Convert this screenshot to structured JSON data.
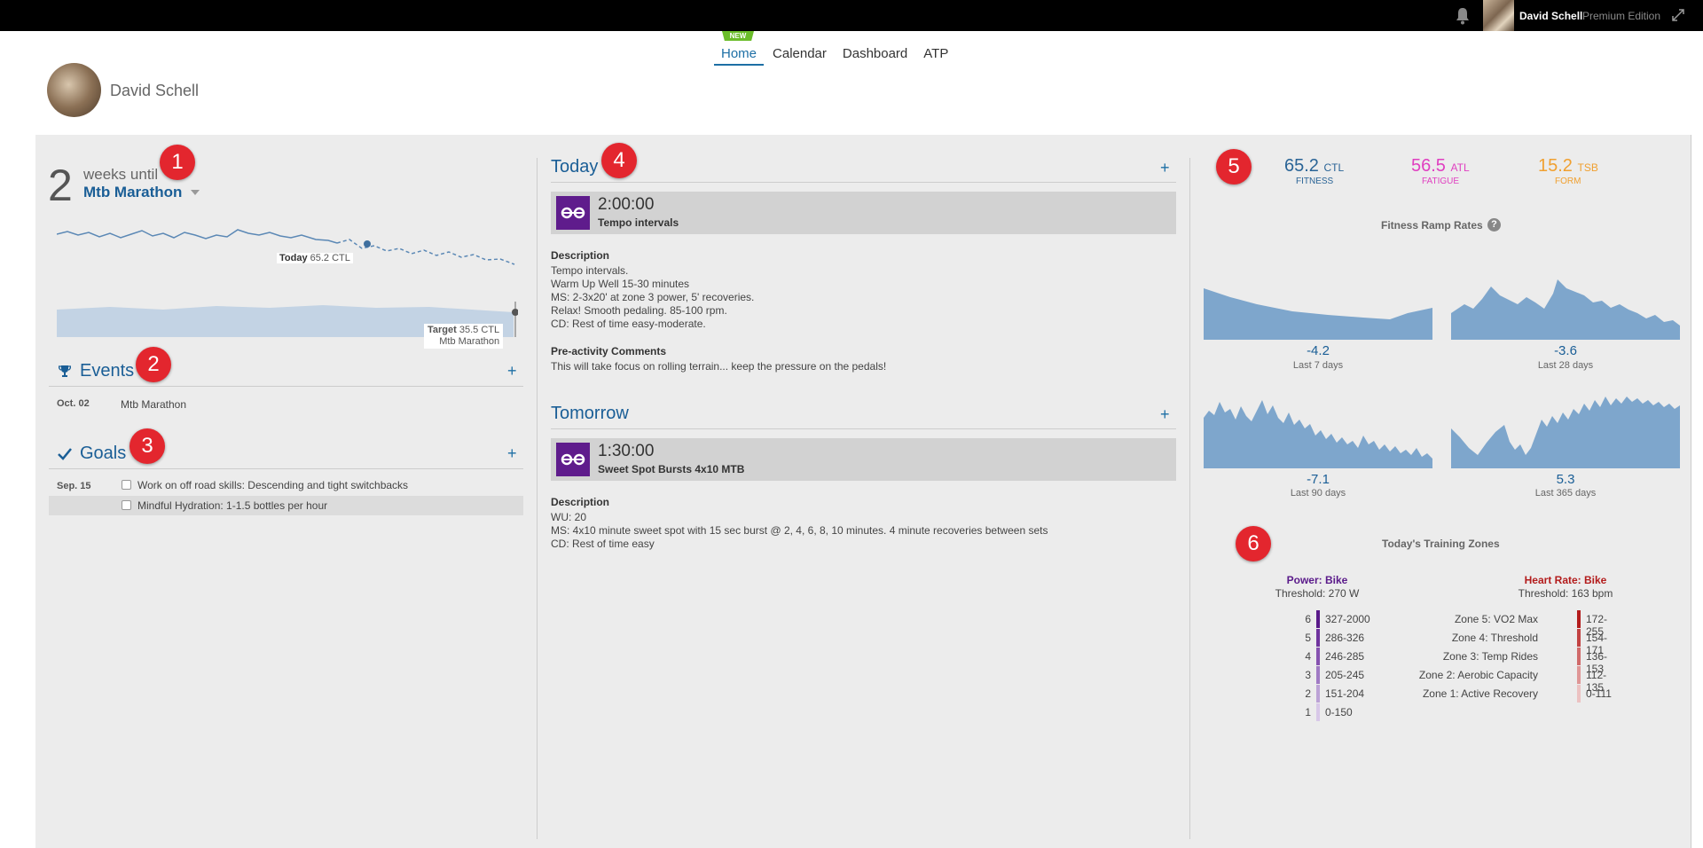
{
  "topbar": {
    "user_name": "David Schell",
    "edition": "Premium Edition"
  },
  "nav": {
    "new_tag": "NEW",
    "items": [
      {
        "label": "Home",
        "active": true
      },
      {
        "label": "Calendar",
        "active": false
      },
      {
        "label": "Dashboard",
        "active": false
      },
      {
        "label": "ATP",
        "active": false
      }
    ]
  },
  "profile": {
    "name": "David Schell"
  },
  "badges": [
    "1",
    "2",
    "3",
    "4",
    "5",
    "6"
  ],
  "countdown": {
    "weeks": "2",
    "weeks_label": "weeks until",
    "event": "Mtb Marathon",
    "today_label": "Today",
    "today_value": "65.2 CTL",
    "target_label": "Target",
    "target_value": "35.5 CTL",
    "target_event": "Mtb Marathon"
  },
  "events": {
    "title": "Events",
    "items": [
      {
        "date": "Oct. 02",
        "name": "Mtb Marathon"
      }
    ]
  },
  "goals": {
    "title": "Goals",
    "date": "Sep. 15",
    "items": [
      "Work on off road skills: Descending and tight switchbacks",
      "Mindful Hydration: 1-1.5 bottles per hour"
    ]
  },
  "today": {
    "title": "Today",
    "duration": "2:00:00",
    "workout": "Tempo intervals",
    "description_label": "Description",
    "description": [
      "Tempo intervals.",
      "Warm Up Well 15-30 minutes",
      "MS: 2-3x20' at zone 3 power, 5' recoveries.",
      "Relax! Smooth pedaling. 85-100 rpm.",
      "CD: Rest of time easy-moderate."
    ],
    "comments_label": "Pre-activity Comments",
    "comments": "This will take focus on rolling terrain... keep the pressure on the pedals!"
  },
  "tomorrow": {
    "title": "Tomorrow",
    "duration": "1:30:00",
    "workout": "Sweet Spot Bursts 4x10 MTB",
    "description_label": "Description",
    "description": [
      "WU: 20",
      "MS: 4x10 minute sweet spot with 15 sec burst @ 2, 4, 6, 8, 10 minutes. 4 minute recoveries between sets",
      "CD: Rest of time easy"
    ]
  },
  "metrics": [
    {
      "value": "65.2",
      "unit": "CTL",
      "label": "FITNESS",
      "color": "#2a6496"
    },
    {
      "value": "56.5",
      "unit": "ATL",
      "label": "FATIGUE",
      "color": "#e03fc0"
    },
    {
      "value": "15.2",
      "unit": "TSB",
      "label": "FORM",
      "color": "#f0a030"
    }
  ],
  "ramp": {
    "title": "Fitness Ramp Rates",
    "help": "?",
    "items": [
      {
        "value": "-4.2",
        "label": "Last 7 days"
      },
      {
        "value": "-3.6",
        "label": "Last 28 days"
      },
      {
        "value": "-7.1",
        "label": "Last 90 days"
      },
      {
        "value": "5.3",
        "label": "Last 365 days"
      }
    ]
  },
  "zones": {
    "title": "Today's Training Zones",
    "power": {
      "title": "Power: Bike",
      "threshold": "Threshold: 270 W",
      "color": "#5a1a8a",
      "rows": [
        {
          "zone": "6",
          "range": "327-2000",
          "color": "#5a1a8a"
        },
        {
          "zone": "5",
          "range": "286-326",
          "color": "#6f339e"
        },
        {
          "zone": "4",
          "range": "246-285",
          "color": "#8652b0"
        },
        {
          "zone": "3",
          "range": "205-245",
          "color": "#a07ac4"
        },
        {
          "zone": "2",
          "range": "151-204",
          "color": "#bca2d6"
        },
        {
          "zone": "1",
          "range": "0-150",
          "color": "#d8c8e8"
        }
      ]
    },
    "hr": {
      "title": "Heart Rate: Bike",
      "threshold": "Threshold: 163 bpm",
      "color": "#b31c1c",
      "rows": [
        {
          "zone": "Zone 5: VO2 Max",
          "range": "172-255",
          "color": "#b31c1c"
        },
        {
          "zone": "Zone 4: Threshold",
          "range": "154-171",
          "color": "#c24242"
        },
        {
          "zone": "Zone 3: Temp Rides",
          "range": "136-153",
          "color": "#d06a6a"
        },
        {
          "zone": "Zone 2: Aerobic Capacity",
          "range": "112-135",
          "color": "#df9696"
        },
        {
          "zone": "Zone 1: Active Recovery",
          "range": "0-111",
          "color": "#ecc2c2"
        }
      ]
    }
  }
}
